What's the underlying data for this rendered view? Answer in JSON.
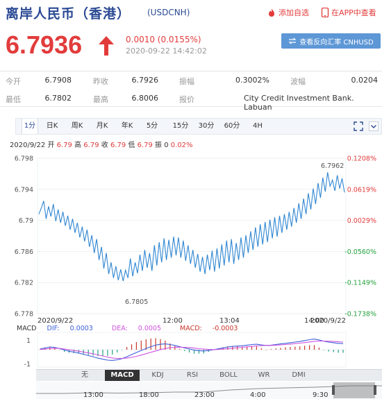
{
  "header": {
    "title": "离岸人民币（香港）",
    "code": "(USDCNH)",
    "add_watchlist": "添加自选",
    "view_in_app": "在APP中查看"
  },
  "quote": {
    "price": "6.7936",
    "change": "0.0010 (0.0155%)",
    "timestamp": "2020-09-22 14:42:02",
    "reverse_button": "查看反向汇率 CNHUSD"
  },
  "stats": [
    [
      {
        "label": "今开",
        "value": "6.7908"
      },
      {
        "label": "昨收",
        "value": "6.7926"
      },
      {
        "label": "振幅",
        "value": "0.3002%"
      },
      {
        "label": "波幅",
        "value": "0.0204"
      }
    ],
    [
      {
        "label": "最低",
        "value": "6.7802"
      },
      {
        "label": "最高",
        "value": "6.8006"
      },
      {
        "label": "报价",
        "value": "City Credit Investment Bank. Labuan"
      }
    ]
  ],
  "tabs": [
    "1分",
    "日K",
    "周K",
    "月K",
    "年K",
    "5分",
    "15分",
    "30分",
    "60分",
    "4H"
  ],
  "active_tab": "1分",
  "summary": {
    "date": "2020/9/22",
    "open_label": "开",
    "open": "6.79",
    "high_label": "高",
    "high": "6.79",
    "close_label": "收",
    "close": "6.79",
    "low_label": "低",
    "low": "6.79",
    "amp_label": "振",
    "amp": "0",
    "pct": "0.02%"
  },
  "chart_data": {
    "type": "line",
    "y_ticks": [
      "6.798",
      "6.794",
      "6.79",
      "6.786",
      "6.782",
      "6.778"
    ],
    "pct_ticks": [
      "0.1208%",
      "0.0619%",
      "0.0029%",
      "-0.0560%",
      "-0.1149%",
      "-0.1738%"
    ],
    "x_labels": [
      "2020/9/22",
      "12:00",
      "13:04",
      "14:00",
      "2020/9/22"
    ],
    "ylim": [
      6.778,
      6.798
    ],
    "high_marker": "6.7962",
    "low_marker": "6.7805",
    "series_color": "#2f86d1",
    "values": [
      6.7908,
      6.7916,
      6.7925,
      6.7902,
      6.7918,
      6.7905,
      6.7921,
      6.7899,
      6.7914,
      6.7897,
      6.7911,
      6.7893,
      6.7906,
      6.7888,
      6.7902,
      6.7884,
      6.7897,
      6.7878,
      6.7892,
      6.7873,
      6.7888,
      6.7866,
      6.7881,
      6.7858,
      6.7876,
      6.7849,
      6.7866,
      6.7838,
      6.7858,
      6.7831,
      6.7846,
      6.7826,
      6.7841,
      6.7823,
      6.7837,
      6.7822,
      6.7836,
      6.7826,
      6.7851,
      6.7828,
      6.7846,
      6.7832,
      6.7856,
      6.7835,
      6.7862,
      6.7839,
      6.7858,
      6.7835,
      6.7868,
      6.7842,
      6.7872,
      6.7846,
      6.7877,
      6.7849,
      6.7875,
      6.7852,
      6.7879,
      6.7855,
      6.7878,
      6.7852,
      6.7874,
      6.7848,
      6.7868,
      6.7844,
      6.7862,
      6.7839,
      6.7857,
      6.7834,
      6.7853,
      6.7831,
      6.7856,
      6.7836,
      6.7861,
      6.7834,
      6.7864,
      6.7838,
      6.7869,
      6.7842,
      6.7874,
      6.7846,
      6.7876,
      6.7844,
      6.7871,
      6.7849,
      6.7878,
      6.7852,
      6.7881,
      6.7858,
      6.7886,
      6.7862,
      6.7891,
      6.7866,
      6.7895,
      6.7869,
      6.7898,
      6.7872,
      6.7901,
      6.7877,
      6.7904,
      6.7879,
      6.7906,
      6.7884,
      6.7908,
      6.7888,
      6.7911,
      6.7892,
      6.7916,
      6.7897,
      6.7922,
      6.7902,
      6.7928,
      6.7908,
      6.7935,
      6.7914,
      6.7941,
      6.7921,
      6.7948,
      6.7929,
      6.7955,
      6.7937,
      6.7962,
      6.7944,
      6.7952,
      6.7938,
      6.7958,
      6.7941,
      6.7954,
      6.7936
    ],
    "macd": {
      "dif_label": "DIF:",
      "dif": "0.0003",
      "dea_label": "DEA:",
      "dea": "0.0005",
      "macd_label": "MACD:",
      "macd": "-0.0003",
      "y_ticks": [
        "1",
        "-1"
      ],
      "dif_color": "#3b5fd9",
      "dea_color": "#d052e0",
      "up_color": "#c8372b",
      "down_color": "#23a085",
      "dif_values": [
        0.05,
        0.12,
        0.18,
        0.15,
        0.08,
        -0.02,
        -0.1,
        -0.16,
        -0.22,
        -0.3,
        -0.38,
        -0.46,
        -0.55,
        -0.62,
        -0.68,
        -0.7,
        -0.66,
        -0.58,
        -0.46,
        -0.32,
        -0.18,
        -0.05,
        0.08,
        0.2,
        0.3,
        0.36,
        0.38,
        0.34,
        0.28,
        0.2,
        0.12,
        0.05,
        -0.02,
        -0.06,
        -0.08,
        -0.05,
        0.0,
        0.06,
        0.12,
        0.18,
        0.22,
        0.24,
        0.26,
        0.3,
        0.34,
        0.36,
        0.32,
        0.28,
        0.3,
        0.34,
        0.38,
        0.42,
        0.46,
        0.5,
        0.54,
        0.6,
        0.66,
        0.7,
        0.64,
        0.56,
        0.5,
        0.46,
        0.42,
        0.4
      ],
      "dea_values": [
        0.02,
        0.05,
        0.08,
        0.1,
        0.09,
        0.05,
        0.0,
        -0.05,
        -0.1,
        -0.15,
        -0.21,
        -0.27,
        -0.34,
        -0.41,
        -0.48,
        -0.54,
        -0.57,
        -0.57,
        -0.55,
        -0.5,
        -0.43,
        -0.35,
        -0.26,
        -0.17,
        -0.08,
        0.01,
        0.08,
        0.13,
        0.16,
        0.17,
        0.16,
        0.14,
        0.11,
        0.07,
        0.04,
        0.02,
        0.01,
        0.02,
        0.04,
        0.07,
        0.1,
        0.13,
        0.16,
        0.19,
        0.22,
        0.25,
        0.27,
        0.28,
        0.28,
        0.3,
        0.32,
        0.34,
        0.37,
        0.4,
        0.43,
        0.47,
        0.51,
        0.55,
        0.57,
        0.57,
        0.56,
        0.54,
        0.52,
        0.5
      ]
    }
  },
  "indicator_tabs": [
    "无",
    "MACD",
    "KDJ",
    "RSI",
    "BOLL",
    "WR",
    "DMI"
  ],
  "active_indicator": "MACD",
  "nav": {
    "left": "▲",
    "right": "▼"
  },
  "overview_labels": [
    "13:00",
    "18:00",
    "23:00",
    "4:00",
    "9:30"
  ]
}
